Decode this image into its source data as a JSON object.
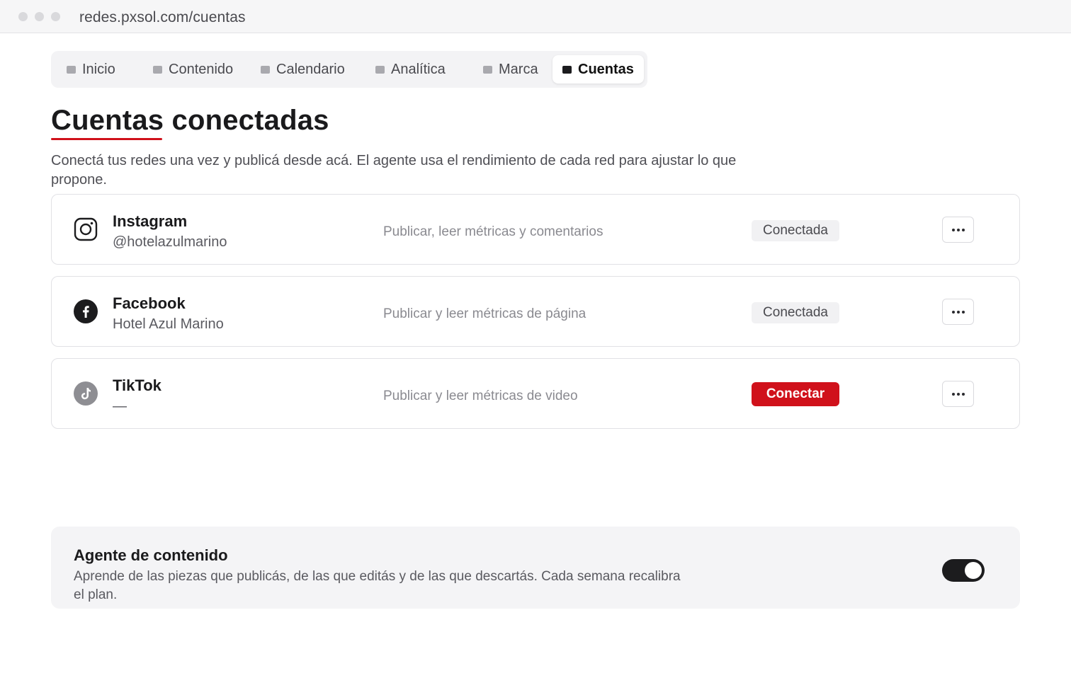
{
  "browser": {
    "url": "redes.pxsol.com/cuentas"
  },
  "tabs": [
    {
      "label": "Inicio"
    },
    {
      "label": "Contenido"
    },
    {
      "label": "Calendario"
    },
    {
      "label": "Analítica"
    },
    {
      "label": "Marca"
    },
    {
      "label": "Cuentas",
      "active": true
    }
  ],
  "header": {
    "title": "Cuentas conectadas",
    "subtitle": "Conectá tus redes una vez y publicá desde acá. El agente usa el rendimiento de cada red para ajustar lo que propone."
  },
  "accounts": [
    {
      "name": "Instagram",
      "handle": "@hotelazulmarino",
      "permissions": "Publicar, leer métricas y comentarios",
      "status": "Conectada",
      "icon": "instagram-icon"
    },
    {
      "name": "Facebook",
      "handle": "Hotel Azul Marino",
      "permissions": "Publicar y leer métricas de página",
      "status": "Conectada",
      "icon": "facebook-icon"
    },
    {
      "name": "TikTok",
      "handle": "—",
      "permissions": "Publicar y leer métricas de video",
      "action": "Conectar",
      "icon": "tiktok-icon"
    }
  ],
  "agent": {
    "title": "Agente de contenido",
    "description": "Aprende de las piezas que publicás, de las que editás y de las que descartás. Cada semana recalibra el plan.",
    "enabled": true
  },
  "colors": {
    "accent": "#d0111b",
    "toggle_on": "#1c1c1e"
  }
}
